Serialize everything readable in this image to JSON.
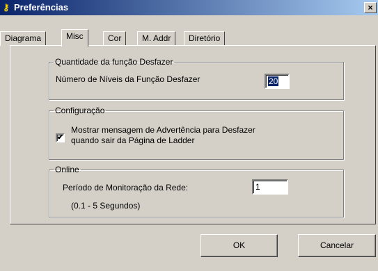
{
  "window": {
    "title": "Preferências",
    "close_glyph": "×"
  },
  "tabs": [
    {
      "label": "Diagrama"
    },
    {
      "label": "Misc",
      "active": true
    },
    {
      "label": "Cor"
    },
    {
      "label": "M. Addr"
    },
    {
      "label": "Diretório"
    }
  ],
  "undo_group": {
    "legend": "Quantidade da função Desfazer",
    "levels_label": "Número de Níveis da Função Desfazer",
    "levels_value": "20"
  },
  "config_group": {
    "legend": "Configuração",
    "warning_checkbox_label_line1": "Mostrar mensagem de Advertência para Desfazer",
    "warning_checkbox_label_line2": "quando sair da Página de Ladder",
    "warning_checked": true,
    "check_glyph": "✔"
  },
  "online_group": {
    "legend": "Online",
    "period_label": "Período de Monitoração da Rede:",
    "period_value": "1",
    "range_hint": "(0.1 - 5 Segundos)"
  },
  "buttons": {
    "ok": "OK",
    "cancel": "Cancelar"
  },
  "icons": {
    "title_icon": "key-icon"
  }
}
